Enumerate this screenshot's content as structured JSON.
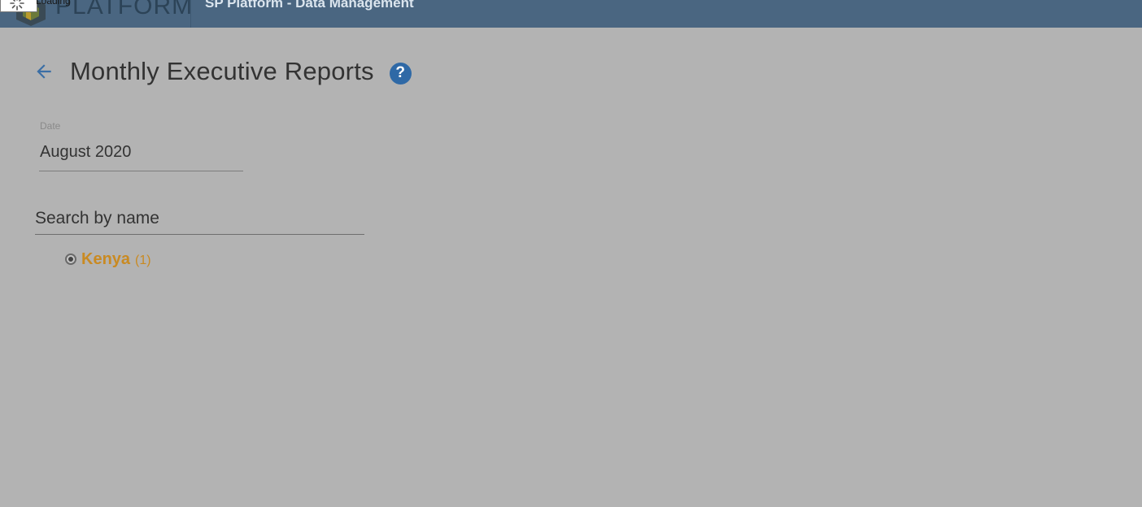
{
  "topbar": {
    "brand_name": "PLATFORM",
    "loading_text": "Loading",
    "app_title": "SP Platform - Data Management"
  },
  "header": {
    "title": "Monthly Executive Reports",
    "help_glyph": "?"
  },
  "date_field": {
    "label": "Date",
    "value": "August 2020"
  },
  "search": {
    "placeholder": "Search by name",
    "value": ""
  },
  "tree": {
    "items": [
      {
        "label": "Kenya",
        "count": "(1)",
        "selected": true
      }
    ]
  },
  "colors": {
    "overlay_bg": "#b3b3b3",
    "topbar": "#4a6681",
    "accent": "#2f69a6",
    "tree_label": "#c98a22"
  },
  "icons": {
    "back": "arrow-left-icon",
    "help": "help-circle-icon",
    "logo": "platform-logo-icon",
    "spinner": "loading-spinner-icon"
  }
}
